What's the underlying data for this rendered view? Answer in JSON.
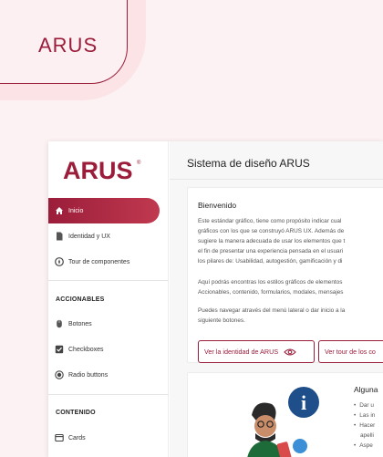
{
  "hero": {
    "title": "ARUS"
  },
  "sidebar": {
    "logo_text": "ARUS",
    "logo_mark": "®",
    "items": [
      {
        "label": "Inicio",
        "icon": "home-icon"
      },
      {
        "label": "Identidad y UX",
        "icon": "document-icon"
      },
      {
        "label": "Tour de componentes",
        "icon": "compass-icon"
      }
    ],
    "sections": [
      {
        "title": "ACCIONABLES",
        "items": [
          {
            "label": "Botones",
            "icon": "mouse-icon"
          },
          {
            "label": "Checkboxes",
            "icon": "checkbox-icon"
          },
          {
            "label": "Radio buttons",
            "icon": "radio-icon"
          }
        ]
      },
      {
        "title": "CONTENIDO",
        "items": [
          {
            "label": "Cards",
            "icon": "card-icon"
          }
        ]
      }
    ]
  },
  "main": {
    "page_title": "Sistema de diseño ARUS",
    "welcome": {
      "title": "Bienvenido",
      "lines": [
        "Este estándar gráfico, tiene como propósito indicar cual",
        "gráficos con los que se construyó ARUS UX. Además de",
        "sugiere la manera adecuada de usar los elementos que t",
        "el fin de presentar una experiencia pensada en el usuari",
        "los pilares de: Usabilidad, autogestión, gamificación y di"
      ],
      "lines2": [
        "Aquí podrás encontras los estilos gráficos de elementos",
        "Accionables, contenido, formularios, modales, mensajes"
      ],
      "lines3": [
        "Puedes navegar através del menú lateral o dar inicio a la",
        "siguiente botones."
      ],
      "button1": "Ver la identidad de ARUS",
      "button2": "Ver tour de los co"
    },
    "info": {
      "title": "Alguna",
      "bullets": [
        "Dar u",
        "Las in",
        "Hacer"
      ],
      "bullet_cont": "apelli",
      "bullet_last": "Aspe",
      "info_glyph": "i"
    }
  },
  "colors": {
    "primary": "#9b1d3a",
    "background": "#fdf2f3"
  }
}
